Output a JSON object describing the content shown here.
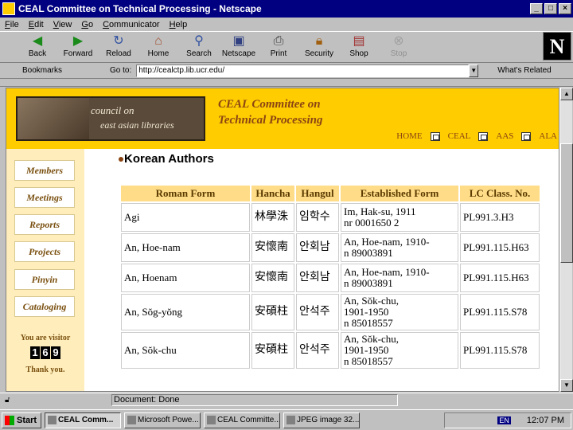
{
  "window": {
    "title": "CEAL Committee on Technical Processing - Netscape",
    "controls": [
      "_",
      "□",
      "×"
    ]
  },
  "menu": [
    "File",
    "Edit",
    "View",
    "Go",
    "Communicator",
    "Help"
  ],
  "toolbar": [
    {
      "label": "Back",
      "icon": "back-arrow-icon"
    },
    {
      "label": "Forward",
      "icon": "forward-arrow-icon"
    },
    {
      "label": "Reload",
      "icon": "reload-icon"
    },
    {
      "label": "Home",
      "icon": "home-icon"
    },
    {
      "label": "Search",
      "icon": "search-icon"
    },
    {
      "label": "Netscape",
      "icon": "netscape-icon"
    },
    {
      "label": "Print",
      "icon": "print-icon"
    },
    {
      "label": "Security",
      "icon": "lock-icon"
    },
    {
      "label": "Shop",
      "icon": "shop-icon"
    },
    {
      "label": "Stop",
      "icon": "stop-icon",
      "disabled": true
    }
  ],
  "location": {
    "bookmarks_label": "Bookmarks",
    "goto_label": "Go to:",
    "url": "http://cealctp.lib.ucr.edu/",
    "related_label": "What's Related"
  },
  "site": {
    "logo_line1": "council on",
    "logo_line2": "east asian libraries",
    "title_line1": "CEAL Committee on",
    "title_line2": "Technical Processing",
    "topnav": [
      "HOME",
      "CEAL",
      "AAS",
      "ALA"
    ],
    "leftnav": [
      "Members",
      "Meetings",
      "Reports",
      "Projects",
      "Pinyin",
      "Cataloging"
    ],
    "visitor_label": "You are visitor",
    "visitor_digits": [
      "1",
      "6",
      "9"
    ],
    "thank_you": "Thank you."
  },
  "page": {
    "heading": "Korean Authors",
    "columns": [
      "Roman Form",
      "Hancha",
      "Hangul",
      "Established Form",
      "LC Class. No."
    ],
    "rows": [
      {
        "roman": "Agi",
        "hancha": "林學洙",
        "hangul": "임학수",
        "established": "Im, Hak-su, 1911\nnr 0001650 2",
        "lc": "PL991.3.H3"
      },
      {
        "roman": "An, Hoe-nam",
        "hancha": "安懷南",
        "hangul": "안회남",
        "established": "An, Hoe-nam, 1910-\nn 89003891",
        "lc": "PL991.115.H63"
      },
      {
        "roman": "An, Hoenam",
        "hancha": "安懷南",
        "hangul": "안회남",
        "established": "An, Hoe-nam, 1910-\nn 89003891",
        "lc": "PL991.115.H63"
      },
      {
        "roman": "An, Sŏg-yŏng",
        "hancha": "安碩柱",
        "hangul": "안석주",
        "established": "An, Sŏk-chu,\n1901-1950\nn 85018557",
        "lc": "PL991.115.S78"
      },
      {
        "roman": "An, Sŏk-chu",
        "hancha": "安碩柱",
        "hangul": "안석주",
        "established": "An, Sŏk-chu,\n1901-1950\nn 85018557",
        "lc": "PL991.115.S78"
      }
    ]
  },
  "status": {
    "text": "Document: Done"
  },
  "taskbar": {
    "start": "Start",
    "tasks": [
      "CEAL Comm...",
      "Microsoft Powe...",
      "CEAL Committe...",
      "JPEG image 32..."
    ],
    "lang": "EN",
    "clock": "12:07 PM"
  }
}
